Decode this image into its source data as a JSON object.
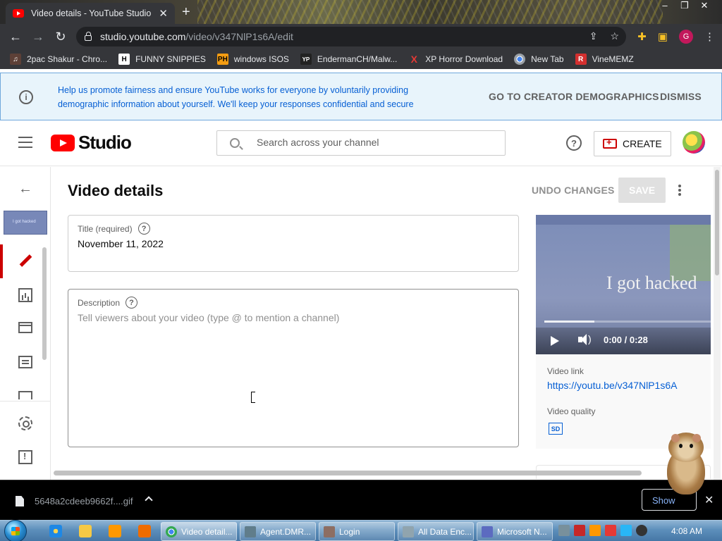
{
  "browser": {
    "tab_title": "Video details - YouTube Studio",
    "url_host": "studio.youtube.com",
    "url_path": "/video/v347NlP1s6A/edit",
    "profile_initial": "G",
    "bookmarks": [
      {
        "label": "2pac Shakur - Chro...",
        "icon": "media-icon",
        "color": "#c0392b"
      },
      {
        "label": "FUNNY SNIPPIES",
        "icon": "h-icon",
        "color": "#ffffff"
      },
      {
        "label": "windows ISOS",
        "icon": "ph-icon",
        "color": "#f39c12"
      },
      {
        "label": "EndermanCH/Malw...",
        "icon": "yp-icon",
        "color": "#333333"
      },
      {
        "label": "XP Horror Download",
        "icon": "x-icon",
        "color": "#e53935"
      },
      {
        "label": "New Tab",
        "icon": "chrome-icon",
        "color": "#9aa0a6"
      },
      {
        "label": "VineMEMZ",
        "icon": "r-icon",
        "color": "#d32f2f"
      }
    ]
  },
  "banner": {
    "text": "Help us promote fairness and ensure YouTube works for everyone by voluntarily providing demographic information about yourself. We'll keep your responses confidential and secure",
    "primary_action": "GO TO CREATOR DEMOGRAPHICS",
    "dismiss": "DISMISS"
  },
  "header": {
    "logo_text": "Studio",
    "search_placeholder": "Search across your channel",
    "help": "?",
    "create_label": "CREATE"
  },
  "sidebar": {
    "thumbnail_text": "I got hacked"
  },
  "main": {
    "title": "Video details",
    "undo_label": "UNDO CHANGES",
    "save_label": "SAVE",
    "title_field": {
      "label": "Title (required)",
      "value": "November 11, 2022"
    },
    "description_field": {
      "label": "Description",
      "placeholder": "Tell viewers about your video (type @ to mention a channel)"
    },
    "help_glyph": "?"
  },
  "preview": {
    "caption": "I got hacked",
    "time": "0:00 / 0:28",
    "progress": 0.3,
    "video_link_label": "Video link",
    "video_link": "https://youtu.be/v347NlP1s6A",
    "video_quality_label": "Video quality",
    "quality_badge": "SD"
  },
  "downloads": {
    "file_name": "5648a2cdeeb9662f....gif",
    "show_all": "Show"
  },
  "taskbar": {
    "items": [
      {
        "label": "Video detail...",
        "active": true,
        "color": "#4caf50"
      },
      {
        "label": "Agent.DMR...",
        "active": false,
        "color": "#607d8b"
      },
      {
        "label": "Login",
        "active": false,
        "color": "#8d6e63"
      },
      {
        "label": "All Data Enc...",
        "active": false,
        "color": "#90a4ae"
      },
      {
        "label": "Microsoft N...",
        "active": false,
        "color": "#5c6bc0"
      }
    ],
    "clock": "4:08 AM"
  }
}
